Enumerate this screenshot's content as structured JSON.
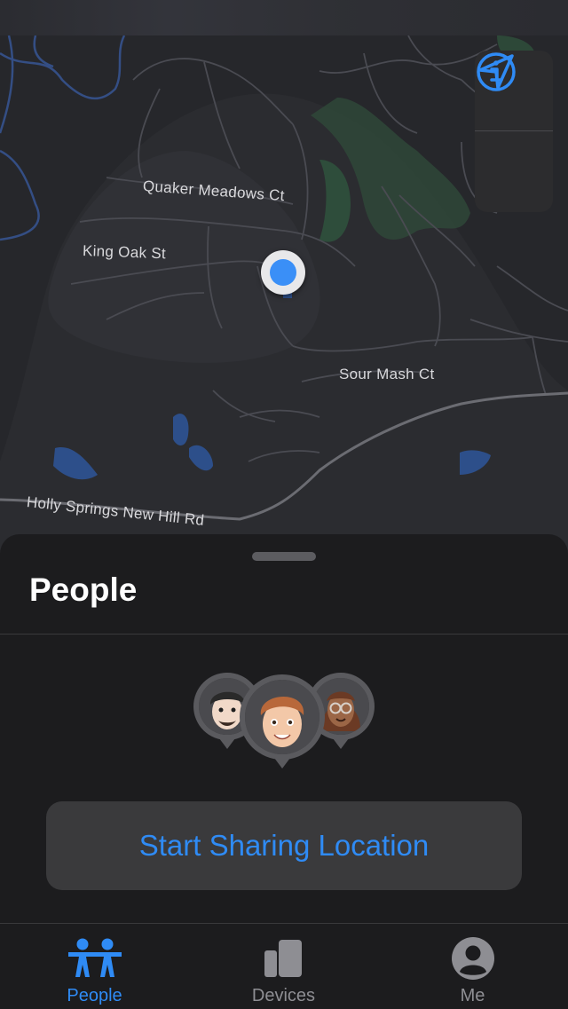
{
  "map": {
    "labels": {
      "quaker": "Quaker Meadows Ct",
      "king": "King Oak St",
      "sour": "Sour Mash Ct",
      "holly": "Holly Springs New Hill Rd"
    },
    "controls": {
      "info_icon": "info-circle-icon",
      "location_icon": "location-arrow-icon"
    },
    "colors": {
      "water": "#2d4f8a",
      "roads": "#4a4b52",
      "accent": "#3a8ff7"
    }
  },
  "sheet": {
    "title": "People",
    "share_button": "Start Sharing Location"
  },
  "tabbar": {
    "tabs": [
      {
        "label": "People",
        "icon": "people-icon",
        "active": true
      },
      {
        "label": "Devices",
        "icon": "devices-icon",
        "active": false
      },
      {
        "label": "Me",
        "icon": "person-circle-icon",
        "active": false
      }
    ],
    "active_color": "#2f8bf5",
    "inactive_color": "#8e8e93"
  }
}
